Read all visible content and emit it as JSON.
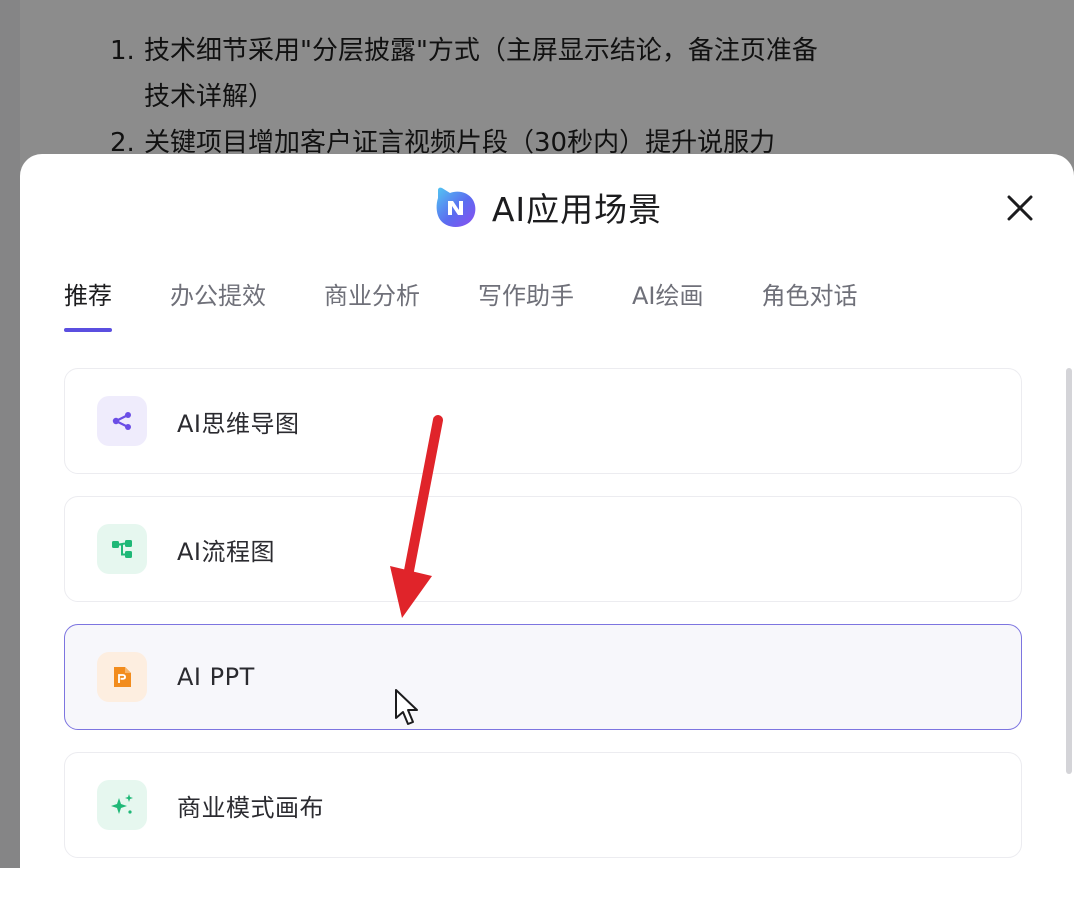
{
  "background": {
    "list": [
      {
        "num": "1.",
        "lines": [
          "技术细节采用\"分层披露\"方式（主屏显示结论，备注页准备",
          "技术详解）"
        ]
      },
      {
        "num": "2.",
        "lines": [
          "关键项目增加客户证言视频片段（30秒内）提升说服力"
        ]
      }
    ]
  },
  "modal": {
    "title": "AI应用场景",
    "logo_icon": "ai-app-logo-icon",
    "close_icon": "close-icon"
  },
  "tabs": [
    {
      "label": "推荐",
      "active": true
    },
    {
      "label": "办公提效",
      "active": false
    },
    {
      "label": "商业分析",
      "active": false
    },
    {
      "label": "写作助手",
      "active": false
    },
    {
      "label": "AI绘画",
      "active": false
    },
    {
      "label": "角色对话",
      "active": false
    }
  ],
  "items": [
    {
      "label": "AI思维导图",
      "icon": "mind-map-icon",
      "color": "#6b4ee6",
      "bg": "#efecfc",
      "selected": false
    },
    {
      "label": "AI流程图",
      "icon": "flowchart-icon",
      "color": "#1fb877",
      "bg": "#e6f7ef",
      "selected": false
    },
    {
      "label": "AI PPT",
      "icon": "ppt-icon",
      "color": "#f28c1d",
      "bg": "#fdeee0",
      "selected": true
    },
    {
      "label": "商业模式画布",
      "icon": "sparkle-icon",
      "color": "#1fb877",
      "bg": "#e6f7ef",
      "selected": false
    }
  ],
  "colors": {
    "accent": "#5b4fe0",
    "annotation_arrow": "#e0242a"
  }
}
